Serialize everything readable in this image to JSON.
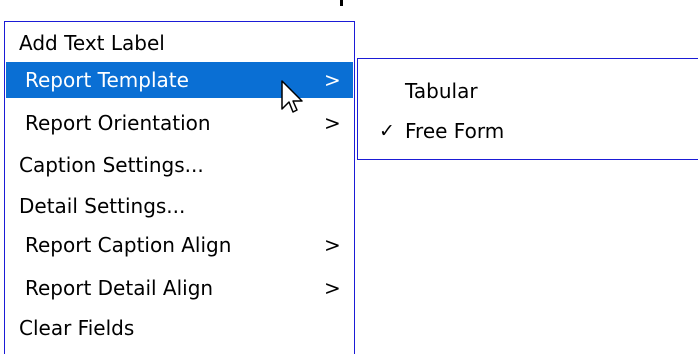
{
  "context_menu": {
    "items": [
      {
        "label": "Add Text Label",
        "arrow": "",
        "highlighted": false,
        "indent": false
      },
      {
        "label": "Report Template",
        "arrow": ">",
        "highlighted": true,
        "indent": true
      },
      {
        "label": "Report Orientation",
        "arrow": ">",
        "highlighted": false,
        "indent": true
      },
      {
        "label": "Caption Settings...",
        "arrow": "",
        "highlighted": false,
        "indent": false
      },
      {
        "label": "Detail Settings...",
        "arrow": "",
        "highlighted": false,
        "indent": false
      },
      {
        "label": "Report Caption Align",
        "arrow": ">",
        "highlighted": false,
        "indent": true
      },
      {
        "label": "Report Detail Align",
        "arrow": ">",
        "highlighted": false,
        "indent": true
      },
      {
        "label": "Clear Fields",
        "arrow": "",
        "highlighted": false,
        "indent": false
      }
    ]
  },
  "submenu": {
    "items": [
      {
        "label": "Tabular",
        "checked": false,
        "check": ""
      },
      {
        "label": "Free Form",
        "checked": true,
        "check": "✓"
      }
    ]
  },
  "colors": {
    "highlight": "#0a6fd4",
    "border": "#1b1bd6"
  },
  "icons": {
    "pointer": "mouse-pointer-icon"
  }
}
